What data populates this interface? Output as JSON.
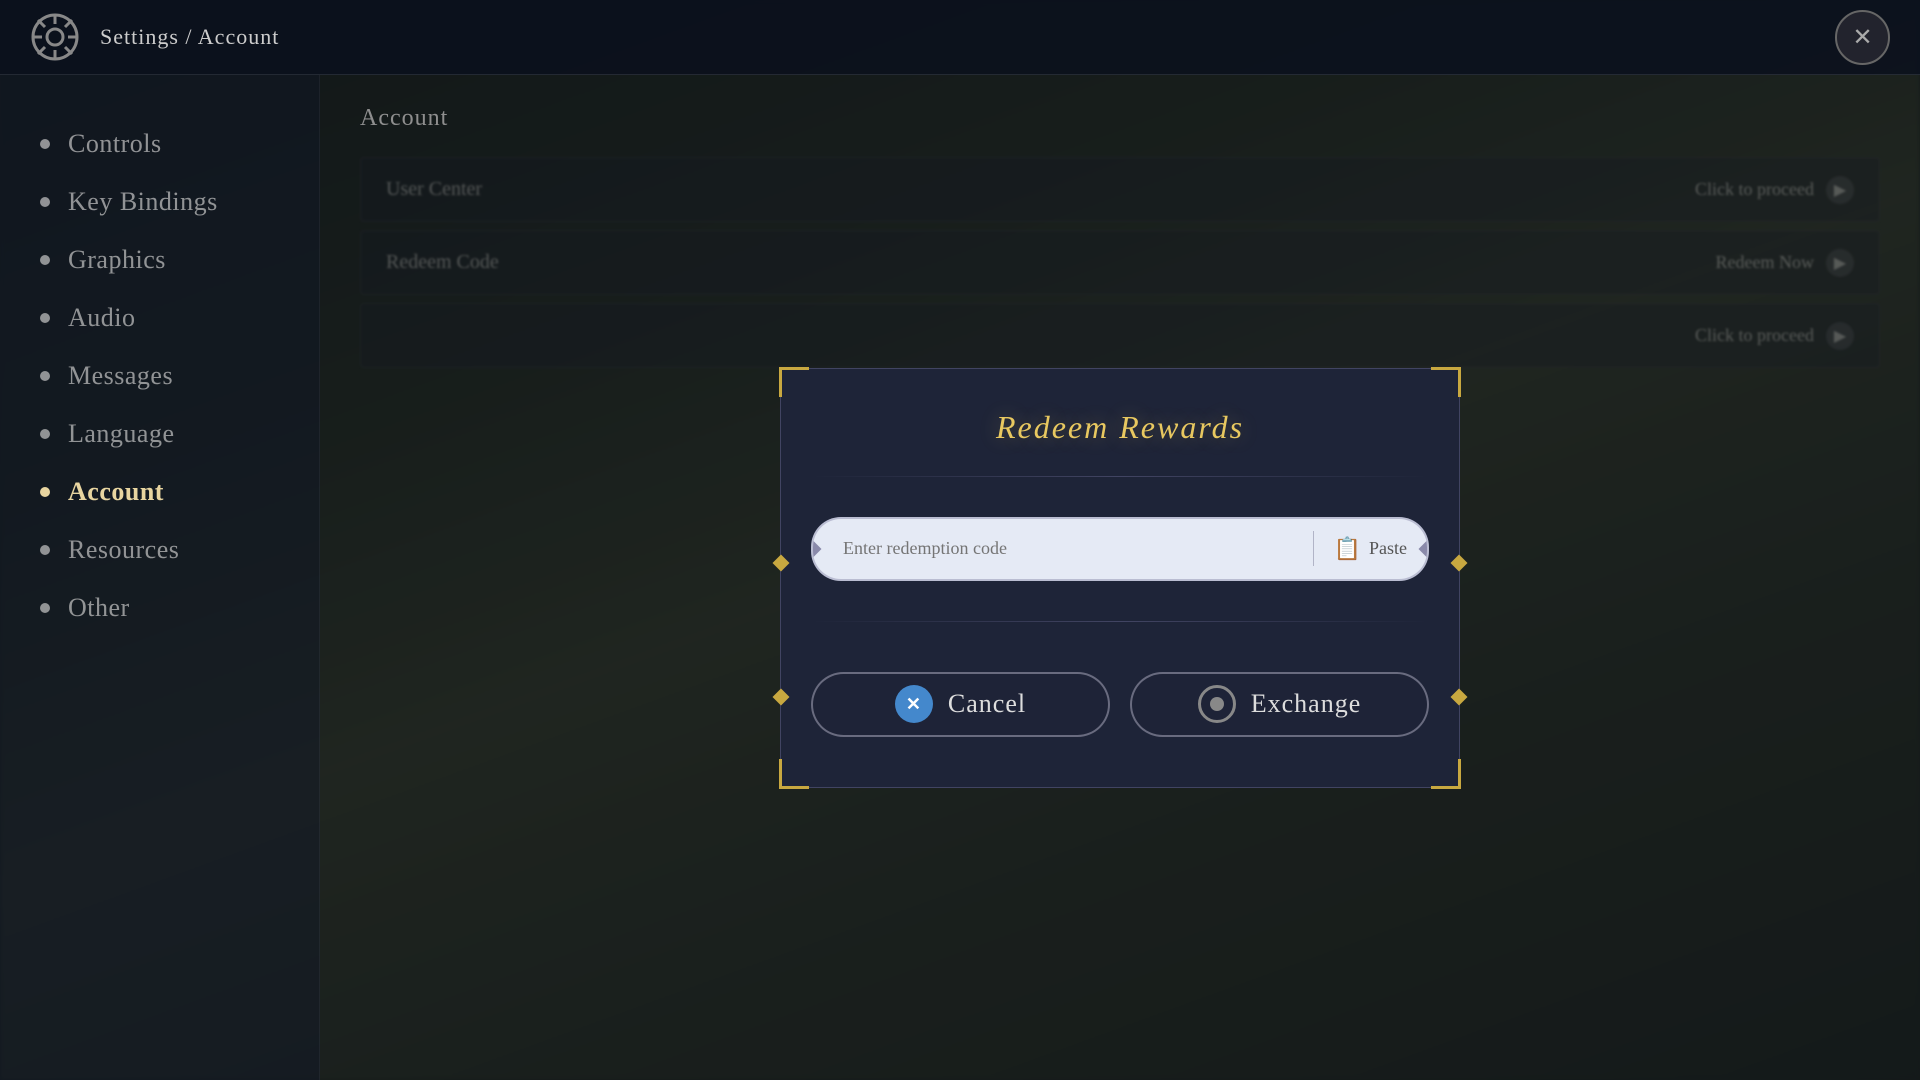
{
  "header": {
    "title": "Settings / Account",
    "close_label": "✕"
  },
  "sidebar": {
    "items": [
      {
        "id": "controls",
        "label": "Controls",
        "active": false
      },
      {
        "id": "key-bindings",
        "label": "Key Bindings",
        "active": false
      },
      {
        "id": "graphics",
        "label": "Graphics",
        "active": false
      },
      {
        "id": "audio",
        "label": "Audio",
        "active": false
      },
      {
        "id": "messages",
        "label": "Messages",
        "active": false
      },
      {
        "id": "language",
        "label": "Language",
        "active": false
      },
      {
        "id": "account",
        "label": "Account",
        "active": true
      },
      {
        "id": "resources",
        "label": "Resources",
        "active": false
      },
      {
        "id": "other",
        "label": "Other",
        "active": false
      }
    ]
  },
  "main": {
    "panel_title": "Account",
    "rows": [
      {
        "id": "user-center",
        "label": "User Center",
        "action": "Click to proceed"
      },
      {
        "id": "redeem-code",
        "label": "Redeem Code",
        "action": "Redeem Now"
      },
      {
        "id": "row3",
        "label": "",
        "action": "Click to proceed"
      }
    ]
  },
  "modal": {
    "title": "Redeem Rewards",
    "input_placeholder": "Enter redemption code",
    "paste_label": "Paste",
    "cancel_label": "Cancel",
    "exchange_label": "Exchange"
  }
}
